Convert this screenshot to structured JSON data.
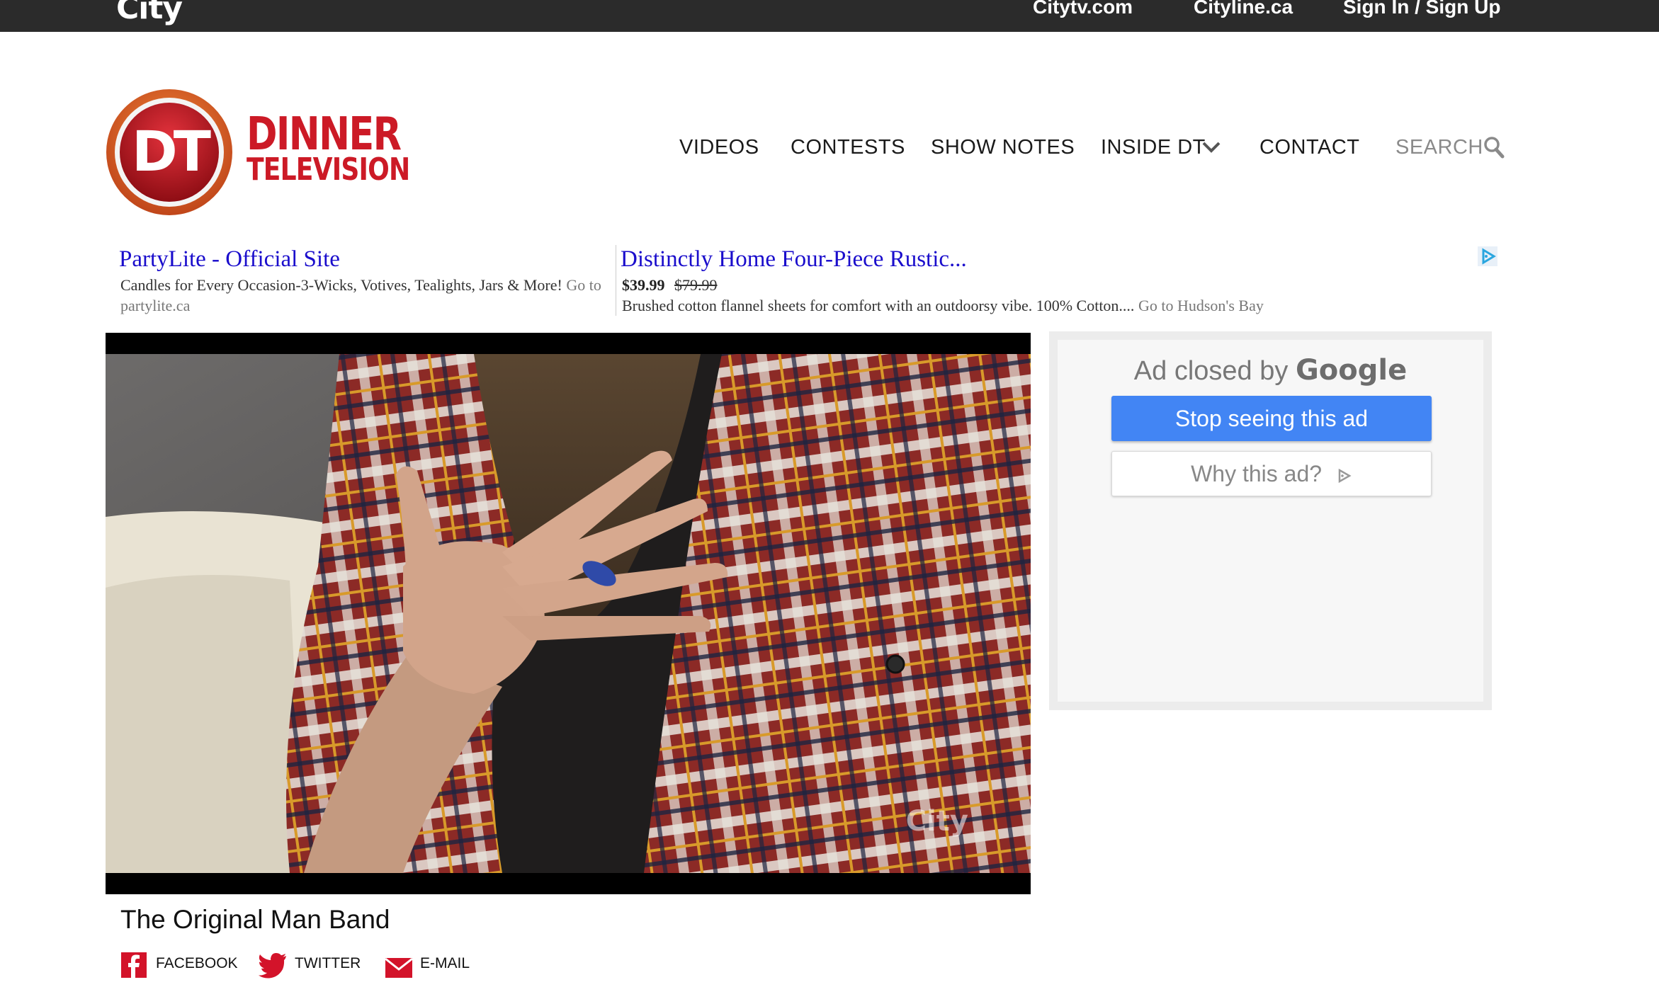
{
  "topbar": {
    "logo": "City",
    "links": [
      "Citytv.com",
      "Cityline.ca",
      "Sign In / Sign Up"
    ]
  },
  "header": {
    "logo_badge": "DT",
    "wordmark_line1": "DINNER",
    "wordmark_line2": "TELEVISION",
    "nav": [
      "VIDEOS",
      "CONTESTS",
      "SHOW NOTES",
      "INSIDE DT",
      "CONTACT"
    ],
    "search_label": "SEARCH"
  },
  "text_ads": [
    {
      "title": "PartyLite - Official Site",
      "description": "Candles for Every Occasion-3-Wicks, Votives, Tealights, Jars & More!",
      "goto": "Go to partylite.ca"
    },
    {
      "title": "Distinctly Home Four-Piece Rustic...",
      "price": "$39.99",
      "old_price": "$79.99",
      "description": "Brushed cotton flannel sheets for comfort with an outdoorsy vibe. 100% Cotton....",
      "goto": "Go to Hudson's Bay"
    }
  ],
  "video": {
    "watermark": "City",
    "title": "The Original Man Band"
  },
  "closed_ad": {
    "text": "Ad closed by",
    "brand": "Google",
    "stop_button": "Stop seeing this ad",
    "why_button": "Why this ad?"
  },
  "share": {
    "facebook": "FACEBOOK",
    "twitter": "TWITTER",
    "email": "E-MAIL"
  },
  "colors": {
    "topbar": "#2b2b2b",
    "brand_red": "#cc1a26",
    "ad_link": "#1a0dcc",
    "google_blue": "#4285f4"
  }
}
